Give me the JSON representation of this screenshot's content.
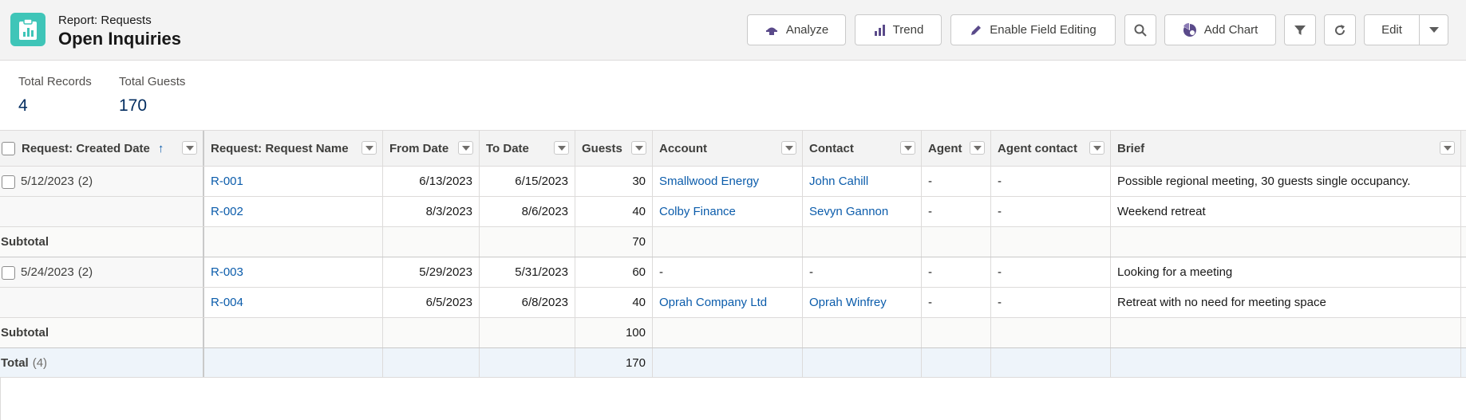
{
  "header": {
    "subtitle": "Report: Requests",
    "title": "Open Inquiries",
    "buttons": {
      "analyze": "Analyze",
      "trend": "Trend",
      "enable_field_editing": "Enable Field Editing",
      "add_chart": "Add Chart",
      "edit": "Edit"
    }
  },
  "summary": {
    "total_records_label": "Total Records",
    "total_records_value": "4",
    "total_guests_label": "Total Guests",
    "total_guests_value": "170"
  },
  "table": {
    "columns": [
      "Request: Created Date",
      "Request: Request Name",
      "From Date",
      "To Date",
      "Guests",
      "Account",
      "Contact",
      "Agent",
      "Agent contact",
      "Brief"
    ],
    "sort_indicator": "↑",
    "groups": [
      {
        "label": "5/12/2023",
        "count": "(2)",
        "rows": [
          {
            "name": "R-001",
            "from": "6/13/2023",
            "to": "6/15/2023",
            "guests": "30",
            "account": "Smallwood Energy",
            "contact": "John Cahill",
            "agent": "-",
            "agent_contact": "-",
            "brief": "Possible regional meeting, 30 guests single occupancy."
          },
          {
            "name": "R-002",
            "from": "8/3/2023",
            "to": "8/6/2023",
            "guests": "40",
            "account": "Colby Finance",
            "contact": "Sevyn Gannon",
            "agent": "-",
            "agent_contact": "-",
            "brief": "Weekend retreat"
          }
        ],
        "subtotal_label": "Subtotal",
        "subtotal_guests": "70"
      },
      {
        "label": "5/24/2023",
        "count": "(2)",
        "rows": [
          {
            "name": "R-003",
            "from": "5/29/2023",
            "to": "5/31/2023",
            "guests": "60",
            "account": "-",
            "contact": "-",
            "agent": "-",
            "agent_contact": "-",
            "brief": "Looking for a meeting"
          },
          {
            "name": "R-004",
            "from": "6/5/2023",
            "to": "6/8/2023",
            "guests": "40",
            "account": "Oprah Company Ltd",
            "contact": "Oprah Winfrey",
            "agent": "-",
            "agent_contact": "-",
            "brief": "Retreat with no need for meeting space"
          }
        ],
        "subtotal_label": "Subtotal",
        "subtotal_guests": "100"
      }
    ],
    "total_label": "Total",
    "total_count": "(4)",
    "total_guests": "170"
  },
  "colors": {
    "brand_icon": "#3fc5b8",
    "link": "#0b5cab",
    "summary_value": "#032d60",
    "total_row_bg": "#eef4fa"
  },
  "icons": [
    "report-icon",
    "analyze-icon",
    "trend-icon",
    "pencil-icon",
    "search-icon",
    "chart-icon",
    "filter-icon",
    "refresh-icon",
    "chevron-down-icon"
  ]
}
